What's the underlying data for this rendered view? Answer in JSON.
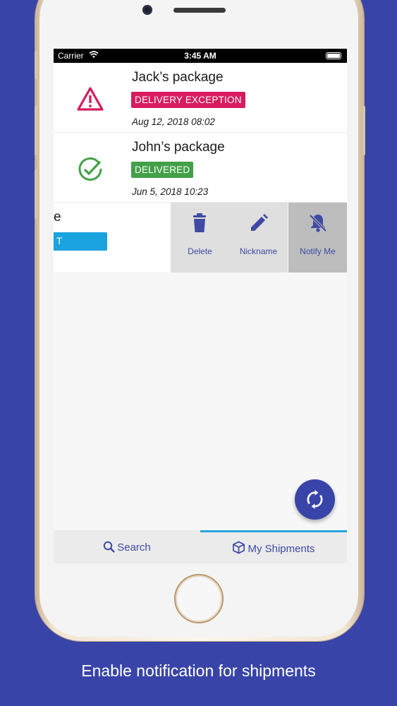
{
  "status_bar": {
    "carrier": "Carrier",
    "time": "3:45 AM"
  },
  "shipments": [
    {
      "name": "Jack’s package",
      "status": "DELIVERY EXCEPTION",
      "status_color": "#d81b60",
      "date": "Aug 12, 2018 08:02",
      "icon": "warning-triangle-icon"
    },
    {
      "name": "John’s package",
      "status": "DELIVERED",
      "status_color": "#43a047",
      "date": "Jun 5, 2018 10:23",
      "icon": "check-circle-icon"
    }
  ],
  "swiped_row": {
    "title_fragment": "e",
    "status_fragment": "T LOCATION",
    "status_color": "#1aa3de"
  },
  "swipe_actions": [
    {
      "label": "Delete",
      "icon": "trash-icon"
    },
    {
      "label": "Nickname",
      "icon": "pencil-icon"
    },
    {
      "label": "Notify Me",
      "icon": "bell-off-icon"
    }
  ],
  "fab": {
    "icon": "refresh-icon"
  },
  "tabs": [
    {
      "label": "Search",
      "icon": "search-icon"
    },
    {
      "label": "My Shipments",
      "icon": "package-icon",
      "active": true
    }
  ],
  "caption": "Enable notification for shipments",
  "colors": {
    "brand": "#3944a8",
    "accent": "#29a3e0"
  }
}
